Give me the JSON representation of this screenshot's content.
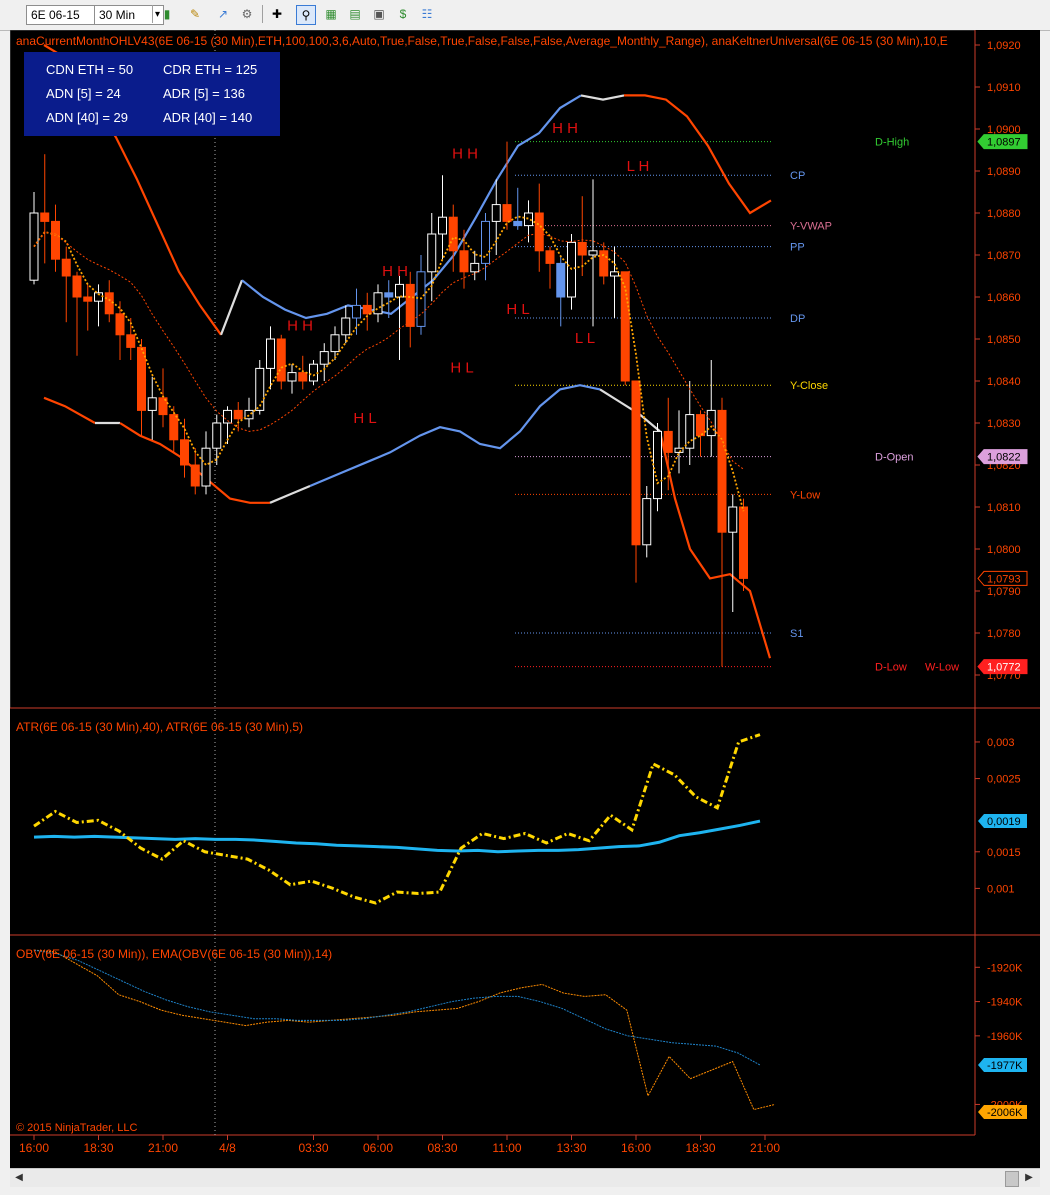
{
  "toolbar": {
    "instrument": "6E 06-15",
    "interval": "30 Min"
  },
  "indicator_labels": {
    "price": "anaCurrentMonthOHLV43(6E  06-15 (30 Min),ETH,100,100,3,6,Auto,True,False,True,False,False,False,Average_Monthly_Range), anaKeltnerUniversal(6E  06-15 (30 Min),10,E",
    "atr": "ATR(6E 06-15 (30 Min),40), ATR(6E 06-15 (30 Min),5)",
    "obv": "OBV(6E 06-15 (30 Min)), EMA(OBV(6E 06-15 (30 Min)),14)"
  },
  "stats": {
    "cdn_eth": "CDN ETH = 50",
    "cdr_eth": "CDR ETH = 125",
    "adn5": "ADN [5] = 24",
    "adr5": "ADR [5] = 136",
    "adn40": "ADN [40] = 29",
    "adr40": "ADR [40] = 140"
  },
  "copyright": "© 2015 NinjaTrader, LLC",
  "colors": {
    "background": "#000000",
    "up_candle": "#ffffff",
    "down_candle": "#ff4500",
    "up_blue": "#6495ed",
    "keltner": "#ff4500",
    "atr40": "#1eb4f0",
    "atr5": "#ffd700",
    "obv": "#ff8c00",
    "obv_ema": "#1e82c8"
  },
  "chart_data": [
    {
      "type": "candlestick",
      "panel": "price",
      "x_ticks": [
        "16:00",
        "18:30",
        "21:00",
        "4/8",
        "03:30",
        "06:00",
        "08:30",
        "11:00",
        "13:30",
        "16:00",
        "18:30",
        "21:00"
      ],
      "ylim": [
        1.0767,
        1.0925
      ],
      "y_ticks": [
        "1,0770",
        "1,0780",
        "1,0790",
        "1,0800",
        "1,0810",
        "1,0820",
        "1,0830",
        "1,0840",
        "1,0850",
        "1,0860",
        "1,0870",
        "1,0880",
        "1,0890",
        "1,0900",
        "1,0910",
        "1,0920"
      ],
      "ohlc": [
        [
          1.0864,
          1.0885,
          1.0863,
          1.088
        ],
        [
          1.088,
          1.0894,
          1.0868,
          1.0878
        ],
        [
          1.0878,
          1.0882,
          1.0866,
          1.0869
        ],
        [
          1.0869,
          1.0872,
          1.0854,
          1.0865
        ],
        [
          1.0865,
          1.0866,
          1.0846,
          1.086
        ],
        [
          1.086,
          1.0863,
          1.0852,
          1.0859
        ],
        [
          1.0859,
          1.0863,
          1.0853,
          1.0861
        ],
        [
          1.0861,
          1.0864,
          1.0854,
          1.0856
        ],
        [
          1.0856,
          1.0859,
          1.0845,
          1.0851
        ],
        [
          1.0851,
          1.0855,
          1.0845,
          1.0848
        ],
        [
          1.0848,
          1.085,
          1.0827,
          1.0833
        ],
        [
          1.0833,
          1.0841,
          1.0826,
          1.0836
        ],
        [
          1.0836,
          1.0843,
          1.0829,
          1.0832
        ],
        [
          1.0832,
          1.0834,
          1.0823,
          1.0826
        ],
        [
          1.0826,
          1.0831,
          1.0817,
          1.082
        ],
        [
          1.082,
          1.0824,
          1.0813,
          1.0815
        ],
        [
          1.0815,
          1.0828,
          1.0813,
          1.0824
        ],
        [
          1.0824,
          1.0832,
          1.082,
          1.083
        ],
        [
          1.083,
          1.0834,
          1.0825,
          1.0833
        ],
        [
          1.0833,
          1.0835,
          1.0828,
          1.0831
        ],
        [
          1.0831,
          1.0836,
          1.0829,
          1.0833
        ],
        [
          1.0833,
          1.0845,
          1.0832,
          1.0843
        ],
        [
          1.0843,
          1.0853,
          1.0838,
          1.085
        ],
        [
          1.085,
          1.0851,
          1.0838,
          1.084
        ],
        [
          1.084,
          1.0844,
          1.0837,
          1.0842
        ],
        [
          1.0842,
          1.0846,
          1.0838,
          1.084
        ],
        [
          1.084,
          1.0845,
          1.0839,
          1.0844
        ],
        [
          1.0844,
          1.0849,
          1.084,
          1.0847
        ],
        [
          1.0847,
          1.0853,
          1.0845,
          1.0851
        ],
        [
          1.0851,
          1.0858,
          1.0849,
          1.0855
        ],
        [
          1.0855,
          1.0862,
          1.0851,
          1.0858
        ],
        [
          1.0858,
          1.0861,
          1.0852,
          1.0856
        ],
        [
          1.0856,
          1.0863,
          1.0854,
          1.0861
        ],
        [
          1.0861,
          1.0864,
          1.0855,
          1.086
        ],
        [
          1.086,
          1.0865,
          1.0845,
          1.0863
        ],
        [
          1.0863,
          1.0866,
          1.0848,
          1.0853
        ],
        [
          1.0853,
          1.087,
          1.0851,
          1.0866
        ],
        [
          1.0866,
          1.088,
          1.0859,
          1.0875
        ],
        [
          1.0875,
          1.0889,
          1.0869,
          1.0879
        ],
        [
          1.0879,
          1.0882,
          1.0866,
          1.0871
        ],
        [
          1.0871,
          1.0876,
          1.0862,
          1.0866
        ],
        [
          1.0866,
          1.0871,
          1.0864,
          1.0868
        ],
        [
          1.0868,
          1.088,
          1.0864,
          1.0878
        ],
        [
          1.0878,
          1.0888,
          1.087,
          1.0882
        ],
        [
          1.0882,
          1.0897,
          1.0876,
          1.0878
        ],
        [
          1.0878,
          1.0886,
          1.0876,
          1.0877
        ],
        [
          1.0877,
          1.0883,
          1.0873,
          1.088
        ],
        [
          1.088,
          1.0887,
          1.0866,
          1.0871
        ],
        [
          1.0871,
          1.0872,
          1.0862,
          1.0868
        ],
        [
          1.0868,
          1.087,
          1.0853,
          1.086
        ],
        [
          1.086,
          1.0875,
          1.0857,
          1.0873
        ],
        [
          1.0873,
          1.0884,
          1.0865,
          1.087
        ],
        [
          1.087,
          1.0888,
          1.0853,
          1.0871
        ],
        [
          1.0871,
          1.0873,
          1.0863,
          1.0865
        ],
        [
          1.0865,
          1.0872,
          1.0855,
          1.0866
        ],
        [
          1.0866,
          1.0866,
          1.0839,
          1.084
        ],
        [
          1.084,
          1.084,
          1.0792,
          1.0801
        ],
        [
          1.0801,
          1.0815,
          1.0798,
          1.0812
        ],
        [
          1.0812,
          1.083,
          1.0809,
          1.0828
        ],
        [
          1.0828,
          1.0836,
          1.0814,
          1.0823
        ],
        [
          1.0823,
          1.0833,
          1.0818,
          1.0824
        ],
        [
          1.0824,
          1.084,
          1.082,
          1.0832
        ],
        [
          1.0832,
          1.0833,
          1.0822,
          1.0827
        ],
        [
          1.0827,
          1.0845,
          1.0822,
          1.0833
        ],
        [
          1.0833,
          1.0836,
          1.0772,
          1.0804
        ],
        [
          1.0804,
          1.0813,
          1.0785,
          1.081
        ],
        [
          1.081,
          1.0812,
          1.079,
          1.0793
        ]
      ],
      "levels": [
        {
          "name": "D-High",
          "value": 1.0897,
          "label": "D-High",
          "color": "#32cd32"
        },
        {
          "name": "CP",
          "value": 1.0889,
          "label": "CP",
          "color": "#6495ed"
        },
        {
          "name": "Y-VWAP",
          "value": 1.0877,
          "label": "Y-VWAP",
          "color": "#db7093"
        },
        {
          "name": "PP",
          "value": 1.0872,
          "label": "PP",
          "color": "#6495ed"
        },
        {
          "name": "DP",
          "value": 1.0855,
          "label": "DP",
          "color": "#6495ed"
        },
        {
          "name": "Y-Close",
          "value": 1.0839,
          "label": "Y-Close",
          "color": "#ffd700"
        },
        {
          "name": "D-Open",
          "value": 1.0822,
          "label": "D-Open",
          "color": "#dda0dd"
        },
        {
          "name": "Y-Low",
          "value": 1.0813,
          "label": "Y-Low",
          "color": "#ff4500"
        },
        {
          "name": "S1",
          "value": 1.078,
          "label": "S1",
          "color": "#6495ed"
        },
        {
          "name": "D-Low",
          "value": 1.0772,
          "label": "D-Low",
          "color": "#ff2020"
        }
      ],
      "w_low_label": "W-Low",
      "price_markers": [
        {
          "label": "1,0897",
          "value": 1.0897,
          "bg": "#32cd32",
          "fg": "#000000"
        },
        {
          "label": "1,0822",
          "value": 1.0822,
          "bg": "#dda0dd",
          "fg": "#000000"
        },
        {
          "label": "1,0793",
          "value": 1.0793,
          "bg": "#000000",
          "fg": "#ff4500"
        },
        {
          "label": "1,0772",
          "value": 1.0772,
          "bg": "#ff2020",
          "fg": "#ffffff"
        }
      ],
      "keltner_upper": [
        [
          34,
          1.092
        ],
        [
          48,
          1.0918
        ],
        [
          64,
          1.0913
        ],
        [
          84,
          1.0906
        ],
        [
          106,
          1.0898
        ],
        [
          127,
          1.0888
        ],
        [
          148,
          1.0877
        ],
        [
          169,
          1.0866
        ],
        [
          190,
          1.0858
        ],
        [
          211,
          1.0851
        ],
        [
          232,
          1.0864
        ],
        [
          253,
          1.086
        ],
        [
          275,
          1.0857
        ],
        [
          296,
          1.0855
        ],
        [
          317,
          1.0856
        ],
        [
          338,
          1.0858
        ],
        [
          360,
          1.0857
        ],
        [
          381,
          1.0856
        ],
        [
          402,
          1.086
        ],
        [
          423,
          1.0864
        ],
        [
          444,
          1.087
        ],
        [
          466,
          1.0879
        ],
        [
          487,
          1.0888
        ],
        [
          508,
          1.0896
        ],
        [
          529,
          1.0899
        ],
        [
          550,
          1.0905
        ],
        [
          571,
          1.0908
        ],
        [
          593,
          1.0907
        ],
        [
          614,
          1.0908
        ],
        [
          635,
          1.0908
        ],
        [
          656,
          1.0907
        ],
        [
          677,
          1.0903
        ],
        [
          698,
          1.0896
        ],
        [
          719,
          1.0887
        ],
        [
          740,
          1.088
        ],
        [
          761,
          1.0883
        ]
      ],
      "keltner_lower": [
        [
          34,
          1.0836
        ],
        [
          55,
          1.0834
        ],
        [
          85,
          1.083
        ],
        [
          110,
          1.083
        ],
        [
          130,
          1.0827
        ],
        [
          150,
          1.0825
        ],
        [
          170,
          1.0822
        ],
        [
          200,
          1.0816
        ],
        [
          220,
          1.0812
        ],
        [
          240,
          1.0811
        ],
        [
          260,
          1.0811
        ],
        [
          280,
          1.0813
        ],
        [
          300,
          1.0815
        ],
        [
          330,
          1.0818
        ],
        [
          360,
          1.0821
        ],
        [
          380,
          1.0823
        ],
        [
          410,
          1.0827
        ],
        [
          430,
          1.0829
        ],
        [
          450,
          1.0828
        ],
        [
          470,
          1.0825
        ],
        [
          490,
          1.0824
        ],
        [
          510,
          1.0828
        ],
        [
          530,
          1.0834
        ],
        [
          550,
          1.0838
        ],
        [
          570,
          1.0839
        ],
        [
          590,
          1.0838
        ],
        [
          610,
          1.0835
        ],
        [
          630,
          1.0832
        ],
        [
          650,
          1.0828
        ],
        [
          665,
          1.0812
        ],
        [
          680,
          1.08
        ],
        [
          700,
          1.0793
        ],
        [
          720,
          1.0794
        ],
        [
          740,
          1.079
        ],
        [
          760,
          1.0774
        ]
      ],
      "high_markers": [
        {
          "label": "H H",
          "x": 455,
          "y": 1.0893
        },
        {
          "label": "H H",
          "x": 555,
          "y": 1.0899
        },
        {
          "label": "H H",
          "x": 385,
          "y": 1.0865
        },
        {
          "label": "H  H",
          "x": 290,
          "y": 1.0852
        }
      ],
      "low_markers": [
        {
          "label": "L  H",
          "x": 628,
          "y": 1.089
        },
        {
          "label": "H  L",
          "x": 508,
          "y": 1.0856
        },
        {
          "label": "L  L",
          "x": 575,
          "y": 1.0849
        },
        {
          "label": "H  L",
          "x": 452,
          "y": 1.0842
        },
        {
          "label": "H  L",
          "x": 355,
          "y": 1.083
        }
      ]
    },
    {
      "type": "line",
      "panel": "atr",
      "ylim": [
        0.0005,
        0.0033
      ],
      "y_ticks": [
        "0,001",
        "0,0015",
        "0,0025",
        "0,003"
      ],
      "series": [
        {
          "name": "ATR(6E 06-15 (30 Min),40)",
          "values": [
            0.0017,
            0.00171,
            0.0017,
            0.00171,
            0.0017,
            0.00169,
            0.00168,
            0.00167,
            0.00168,
            0.00167,
            0.00167,
            0.00166,
            0.00164,
            0.00162,
            0.00161,
            0.00159,
            0.00158,
            0.00157,
            0.00156,
            0.00154,
            0.00152,
            0.00151,
            0.00152,
            0.0015,
            0.00151,
            0.00152,
            0.00152,
            0.00153,
            0.00155,
            0.00157,
            0.00158,
            0.00163,
            0.00172,
            0.00176,
            0.00181,
            0.00186,
            0.00192
          ],
          "marker_label": "0,0019"
        },
        {
          "name": "ATR(6E 06-15 (30 Min),5)",
          "values": [
            0.00185,
            0.00205,
            0.0019,
            0.00193,
            0.00178,
            0.00155,
            0.0014,
            0.00165,
            0.0015,
            0.00145,
            0.0014,
            0.00125,
            0.00105,
            0.0011,
            0.001,
            0.00088,
            0.0008,
            0.00095,
            0.00093,
            0.00095,
            0.00155,
            0.00175,
            0.00168,
            0.00175,
            0.00162,
            0.00175,
            0.00165,
            0.002,
            0.0018,
            0.0027,
            0.00255,
            0.00225,
            0.0021,
            0.003,
            0.0031
          ]
        }
      ]
    },
    {
      "type": "line",
      "panel": "obv",
      "ylim": [
        -2012,
        -1907
      ],
      "y_ticks": [
        "-1920K",
        "-1940K",
        "-1960K",
        "-2000K"
      ],
      "series": [
        {
          "name": "OBV(6E 06-15 (30 Min))",
          "values": [
            -1910,
            -1911,
            -1918,
            -1925,
            -1936,
            -1940,
            -1945,
            -1948,
            -1950,
            -1952,
            -1954,
            -1952,
            -1951,
            -1952,
            -1951,
            -1950,
            -1949,
            -1948,
            -1946,
            -1945,
            -1944,
            -1940,
            -1935,
            -1932,
            -1930,
            -1935,
            -1937,
            -1936,
            -1945,
            -1995,
            -1972,
            -1985,
            -1980,
            -1975,
            -2003,
            -2000
          ],
          "marker_label": "-2006K"
        },
        {
          "name": "EMA(OBV(6E 06-15 (30 Min)),14)",
          "values": [
            -1910,
            -1912,
            -1916,
            -1922,
            -1928,
            -1934,
            -1939,
            -1943,
            -1946,
            -1948,
            -1950,
            -1950,
            -1951,
            -1951,
            -1951,
            -1950,
            -1948,
            -1946,
            -1943,
            -1940,
            -1938,
            -1937,
            -1937,
            -1940,
            -1944,
            -1950,
            -1956,
            -1960,
            -1962,
            -1964,
            -1965,
            -1966,
            -1970,
            -1977
          ],
          "marker_label": "-1977K"
        }
      ]
    }
  ]
}
